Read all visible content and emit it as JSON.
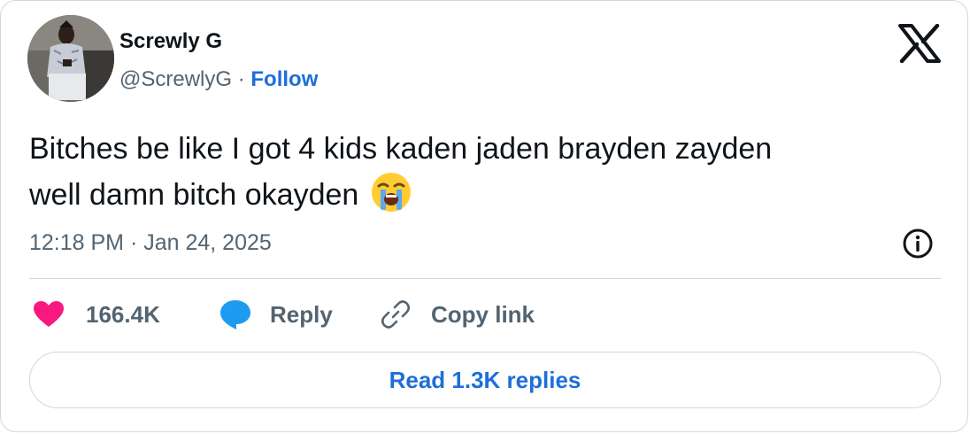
{
  "author": {
    "name": "Screwly G",
    "handle": "@ScrewlyG",
    "separator": "·",
    "follow_label": "Follow"
  },
  "tweet": {
    "line1": "Bitches be like I got 4 kids kaden jaden brayden zayden",
    "line2": "well damn bitch okayden",
    "emoji_icon": "loudly-crying-face-icon",
    "timestamp": "12:18 PM · Jan 24, 2025"
  },
  "actions": {
    "likes_count": "166.4K",
    "reply_label": "Reply",
    "copy_link_label": "Copy link",
    "read_replies_label": "Read 1.3K replies"
  },
  "icons": {
    "brand": "x-logo-icon",
    "info": "info-icon",
    "like": "heart-icon",
    "reply": "reply-bubble-icon",
    "link": "link-icon"
  },
  "colors": {
    "text_primary": "#0f1419",
    "text_secondary": "#536471",
    "link_blue": "#1d6fd8",
    "heart_pink": "#f91880",
    "reply_blue": "#1d9bf0",
    "border": "#cfd9de"
  }
}
